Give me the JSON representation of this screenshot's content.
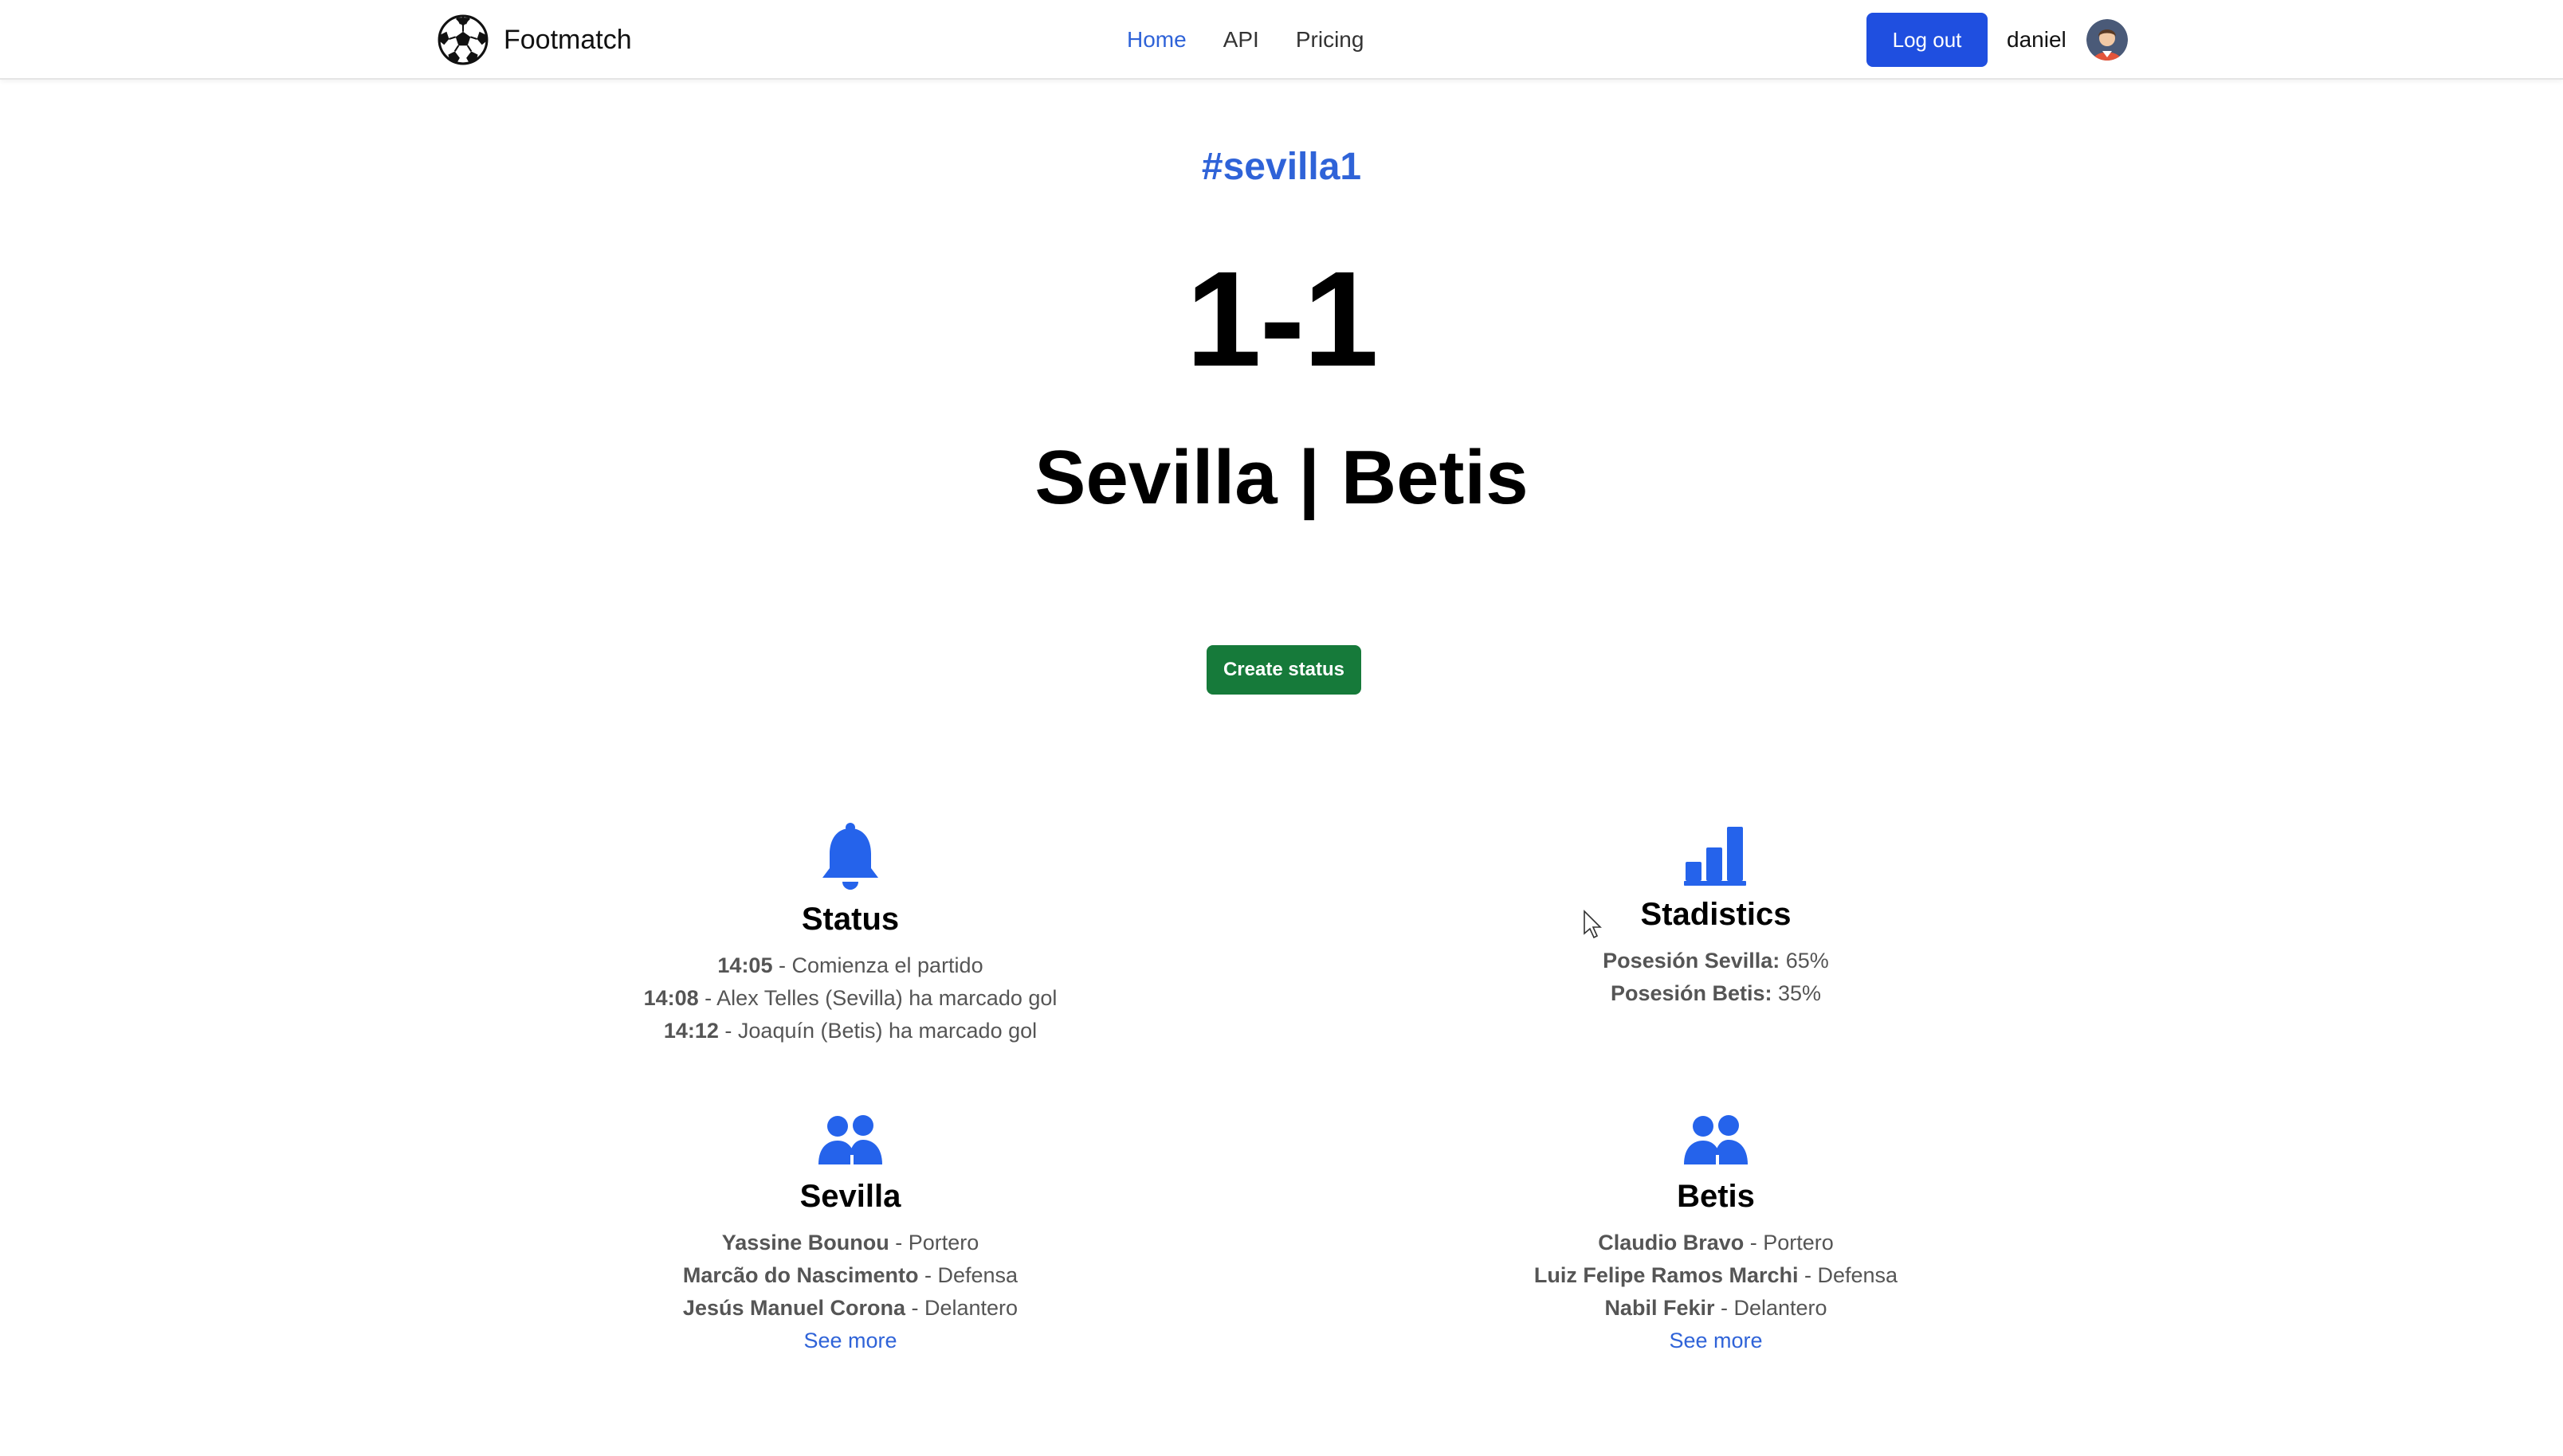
{
  "brand": {
    "name": "Footmatch",
    "logo_icon": "soccer-ball-icon"
  },
  "nav": {
    "links": [
      {
        "label": "Home",
        "active": true
      },
      {
        "label": "API",
        "active": false
      },
      {
        "label": "Pricing",
        "active": false
      }
    ],
    "logout_label": "Log out",
    "username": "daniel"
  },
  "match": {
    "hashtag": "#sevilla1",
    "score": "1-1",
    "teams": "Sevilla | Betis",
    "create_status_label": "Create status"
  },
  "status_card": {
    "icon": "bell-icon",
    "title": "Status",
    "items": [
      {
        "time": "14:05",
        "text": " - Comienza el partido"
      },
      {
        "time": "14:08",
        "text": " - Alex Telles (Sevilla) ha marcado gol"
      },
      {
        "time": "14:12",
        "text": " - Joaquín (Betis) ha marcado gol"
      }
    ]
  },
  "stats_card": {
    "icon": "bar-chart-icon",
    "title": "Stadistics",
    "items": [
      {
        "label": "Posesión Sevilla:",
        "value": " 65%"
      },
      {
        "label": "Posesión Betis:",
        "value": " 35%"
      }
    ]
  },
  "sevilla_card": {
    "icon": "people-icon",
    "title": "Sevilla",
    "players": [
      {
        "name": "Yassine Bounou",
        "role": " - Portero"
      },
      {
        "name": "Marcão do Nascimento",
        "role": " - Defensa"
      },
      {
        "name": "Jesús Manuel Corona",
        "role": " - Delantero"
      }
    ],
    "see_more": "See more"
  },
  "betis_card": {
    "icon": "people-icon",
    "title": "Betis",
    "players": [
      {
        "name": "Claudio Bravo",
        "role": " - Portero"
      },
      {
        "name": "Luiz Felipe Ramos Marchi",
        "role": " - Defensa"
      },
      {
        "name": "Nabil Fekir",
        "role": " - Delantero"
      }
    ],
    "see_more": "See more"
  },
  "colors": {
    "primary_blue": "#1f4fe0",
    "link_blue": "#2f63d8",
    "icon_blue": "#2563eb",
    "success_green": "#167a3a"
  }
}
